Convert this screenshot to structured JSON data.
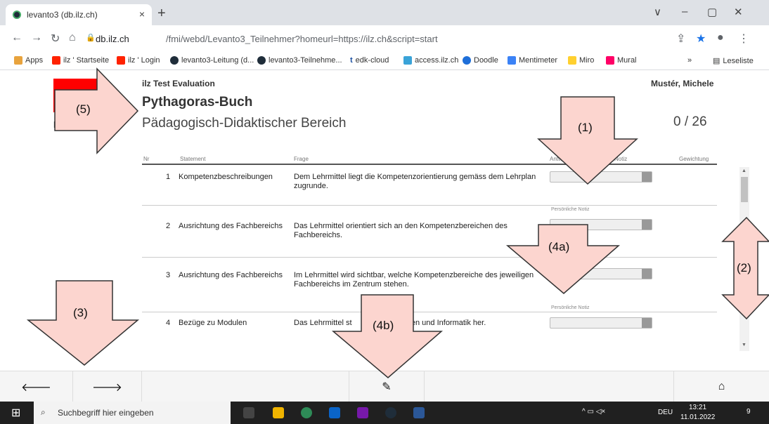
{
  "browser": {
    "tab_title": "levanto3 (db.ilz.ch)",
    "tab_close": "×",
    "new_tab": "+",
    "win_minimize": "–",
    "win_restore": "▢",
    "win_close": "✕",
    "win_menu": "∨",
    "url_host": "db.ilz.ch",
    "url_path": "/fmi/webd/Levanto3_Teilnehmer?homeurl=https://ilz.ch&script=start",
    "bookmarks": [
      {
        "label": "Apps",
        "color": "#e8a33d"
      },
      {
        "label": "ilz ' Startseite",
        "color": "#ff2200"
      },
      {
        "label": "ilz ' Login",
        "color": "#ff2200"
      },
      {
        "label": "levanto3-Leitung (d...",
        "color": "#1f2d3a"
      },
      {
        "label": "levanto3-Teilnehme...",
        "color": "#1f2d3a"
      },
      {
        "label": "edk-cloud",
        "color": "#ffffff"
      },
      {
        "label": "access.ilz.ch",
        "color": "#3aa3d8"
      },
      {
        "label": "Doodle",
        "color": "#1e6fd9"
      },
      {
        "label": "Mentimeter",
        "color": "#3b82f6"
      },
      {
        "label": "Miro",
        "color": "#ffd02f"
      },
      {
        "label": "Mural",
        "color": "#ff0066"
      }
    ],
    "bookmarks_more": "»",
    "reading_list": "Leseliste"
  },
  "app": {
    "title": "ilz Test Evaluation",
    "user": "Mustér, Michele",
    "logo_letter": "L",
    "book_title": "Pythagoras-Buch",
    "section_title": "Pädagogisch-Didaktischer Bereich",
    "progress": "0 / 26",
    "columns": {
      "nr": "Nr",
      "statement": "Statement",
      "question": "Frage",
      "answer": "Antw",
      "note": "Notiz",
      "weight": "Gewichtung"
    },
    "note_label": "Persönliche Notiz",
    "rows": [
      {
        "nr": "1",
        "statement": "Kompetenzbeschreibungen",
        "question": "Dem Lehrmittel liegt die Kompetenzorientierung gemäss dem Lehrplan zugrunde."
      },
      {
        "nr": "2",
        "statement": "Ausrichtung des Fachbereichs",
        "question": "Das Lehrmittel orientiert sich an den Kompetenzbereichen des Fachbereichs."
      },
      {
        "nr": "3",
        "statement": "Ausrichtung des Fachbereichs",
        "question": "Im Lehrmittel wird sichtbar, welche Kompetenzbereiche des jeweiligen Fachbereichs im Zentrum stehen."
      },
      {
        "nr": "4",
        "statement": "Bezüge zu Modulen",
        "question": "Das Lehrmittel st     m Modul Medien und Informatik her."
      }
    ],
    "bottom_bar": {
      "prev_icon": "arrow-left-icon",
      "next_icon": "arrow-right-icon",
      "edit_icon": "pencil-icon",
      "home_icon": "home-icon"
    }
  },
  "annotations": {
    "label_1": "(1)",
    "label_2": "(2)",
    "label_3": "(3)",
    "label_4a": "(4a)",
    "label_4b": "(4b)",
    "label_5": "(5)",
    "fill": "#fcd5cf",
    "stroke": "#333333"
  },
  "taskbar": {
    "search_placeholder": "Suchbegriff hier eingeben",
    "tray_lang": "DEU",
    "time": "13:21",
    "date": "11.01.2022",
    "notifications": "9"
  }
}
